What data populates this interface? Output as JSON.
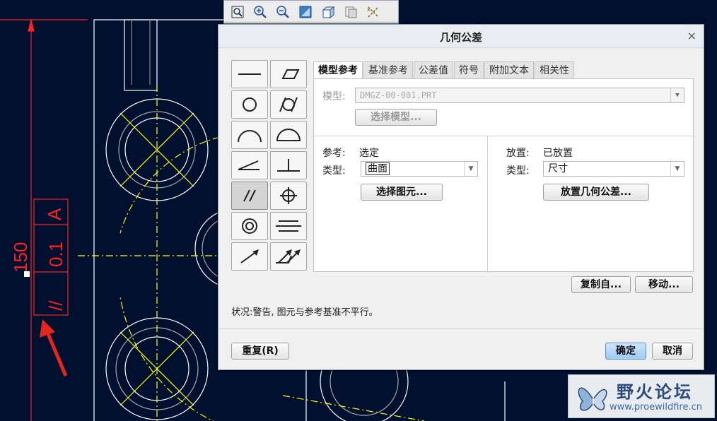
{
  "toolbar": {
    "icons": [
      "zoom-window-icon",
      "zoom-in-icon",
      "zoom-out-icon",
      "refit-icon",
      "orientation-icon",
      "saved-views-icon",
      "datum-display-icon"
    ]
  },
  "drawing": {
    "dimension_value": "150",
    "gtol_symbol": "//",
    "gtol_value": "0.1",
    "gtol_datum": "A"
  },
  "dialog": {
    "title": "几何公差",
    "close": "×",
    "tabs": [
      "模型参考",
      "基准参考",
      "公差值",
      "符号",
      "附加文本",
      "相关性"
    ],
    "active_tab": 0,
    "model": {
      "label": "模型:",
      "value": "DMGZ-00-001.PRT",
      "select_button": "选择模型..."
    },
    "reference": {
      "ref_label": "参考:",
      "ref_value": "选定",
      "type_label": "类型:",
      "type_value": "曲面",
      "select_button": "选择图元..."
    },
    "placement": {
      "label": "放置:",
      "value": "已放置",
      "type_label": "类型:",
      "type_value": "尺寸",
      "place_button": "放置几何公差..."
    },
    "copy_button": "复制自...",
    "move_button": "移动...",
    "status": "状况:警告, 图元与参考基准不平行。",
    "repeat_button": "重复(R)",
    "ok_button": "确定",
    "cancel_button": "取消"
  },
  "watermark": {
    "title": "野火论坛",
    "url": "www.proewildfire.cn"
  },
  "colors": {
    "background": "#00102e",
    "drawing_lines": "#ffffff",
    "centerlines": "#ffff00",
    "dimension": "#ff2020",
    "annotation_arrow": "#e8251d"
  }
}
